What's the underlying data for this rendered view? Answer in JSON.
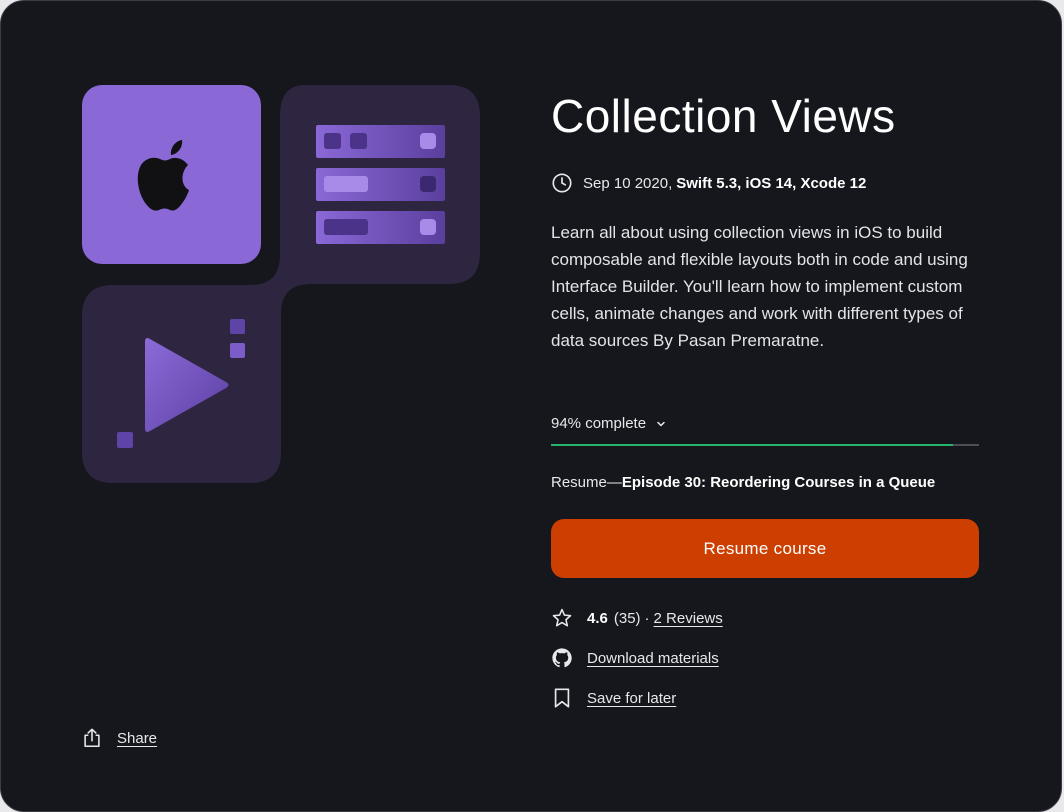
{
  "course": {
    "title": "Collection Views",
    "date": "Sep 10 2020,",
    "tech": "Swift 5.3, iOS 14, Xcode 12",
    "description": "Learn all about using collection views in iOS to build composable and flexible layouts both in code and using Interface Builder. You'll learn how to implement custom cells, animate changes and work with different types of data sources By Pasan Premaratne."
  },
  "progress": {
    "label": "94% complete",
    "percent": 94
  },
  "resume": {
    "prefix": "Resume—",
    "episode": "Episode 30: Reordering Courses in a Queue",
    "button_label": "Resume course"
  },
  "rating": {
    "value": "4.6",
    "count": "(35)",
    "separator": "·",
    "reviews_link": "2 Reviews"
  },
  "actions": {
    "download_label": "Download materials",
    "save_label": "Save for later",
    "share_label": "Share"
  },
  "colors": {
    "background": "#15171c",
    "accent_orange": "#cc3f00",
    "progress_green": "#27b26b",
    "artwork_purple": "#8a68d6",
    "artwork_dark": "#2e2640"
  },
  "icons": [
    "apple-logo-icon",
    "clock-icon",
    "chevron-down-icon",
    "star-icon",
    "github-icon",
    "bookmark-icon",
    "share-icon",
    "play-icon"
  ]
}
